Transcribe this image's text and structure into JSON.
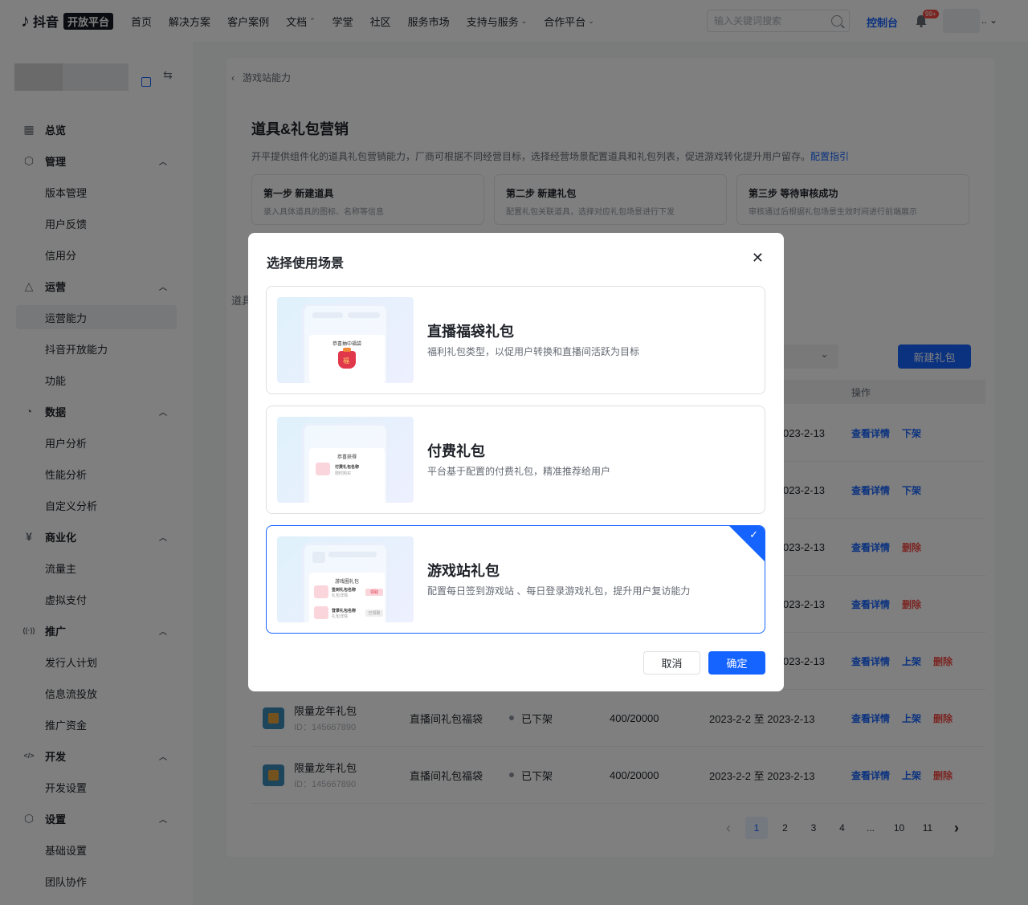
{
  "header": {
    "logo_text": "抖音",
    "logo_badge": "开放平台",
    "nav": [
      "首页",
      "解决方案",
      "客户案例",
      "文档",
      "学堂",
      "社区",
      "服务市场",
      "支持与服务",
      "合作平台"
    ],
    "nav_dropdowns": [
      false,
      false,
      false,
      true,
      false,
      false,
      false,
      true,
      true
    ],
    "search_placeholder": "输入关键词搜索",
    "console": "控制台",
    "bell_badge": "99+",
    "user_name": ".."
  },
  "sidebar": {
    "groups": [
      {
        "label": "总览",
        "icon": "dashboard-icon",
        "items": []
      },
      {
        "label": "管理",
        "icon": "cube-icon",
        "items": [
          "版本管理",
          "用户反馈",
          "信用分"
        ]
      },
      {
        "label": "运营",
        "icon": "operation-icon",
        "items": [
          "运营能力",
          "抖音开放能力",
          "功能"
        ]
      },
      {
        "label": "数据",
        "icon": "pie-chart-icon",
        "items": [
          "用户分析",
          "性能分析",
          "自定义分析"
        ]
      },
      {
        "label": "商业化",
        "icon": "yuan-icon",
        "items": [
          "流量主",
          "虚拟支付"
        ]
      },
      {
        "label": "推广",
        "icon": "broadcast-icon",
        "items": [
          "发行人计划",
          "信息流投放",
          "推广资金"
        ]
      },
      {
        "label": "开发",
        "icon": "code-icon",
        "items": [
          "开发设置"
        ]
      },
      {
        "label": "设置",
        "icon": "settings-icon",
        "items": [
          "基础设置",
          "团队协作"
        ]
      }
    ],
    "active_item": "运营能力"
  },
  "page": {
    "breadcrumb": "游戏站能力",
    "title": "道具&礼包营销",
    "desc": "开平提供组件化的道具礼包营销能力，厂商可根据不同经营目标，选择经营场景配置道具和礼包列表，促进游戏转化提升用户留存。",
    "desc_link": "配置指引",
    "steps": [
      {
        "title": "第一步 新建道具",
        "desc": "录入具体道具的图标、名称等信息"
      },
      {
        "title": "第二步 新建礼包",
        "desc": "配置礼包关联道具，选择对应礼包场景进行下发"
      },
      {
        "title": "第三步 等待审核成功",
        "desc": "审核通过后根据礼包场景生效时间进行前端展示"
      }
    ],
    "tab_label": "道具",
    "new_button": "新建礼包",
    "op_header": "操作",
    "date_tails": [
      "023-2-13",
      "023-2-13",
      "023-2-13",
      "023-2-13",
      "023-2-13"
    ],
    "partial_actions": [
      [
        "查看详情",
        "下架"
      ],
      [
        "查看详情",
        "下架"
      ],
      [
        "查看详情",
        "删除"
      ],
      [
        "查看详情",
        "删除"
      ],
      [
        "查看详情",
        "上架",
        "删除"
      ]
    ],
    "rows": [
      {
        "name": "限量龙年礼包",
        "id": "ID：145667890",
        "type": "直播间礼包福袋",
        "status": "已下架",
        "stock": "400/20000",
        "date": "2023-2-2 至 2023-2-13",
        "actions": [
          "查看详情",
          "上架",
          "删除"
        ]
      },
      {
        "name": "限量龙年礼包",
        "id": "ID：145667890",
        "type": "直播间礼包福袋",
        "status": "已下架",
        "stock": "400/20000",
        "date": "2023-2-2 至 2023-2-13",
        "actions": [
          "查看详情",
          "上架",
          "删除"
        ]
      }
    ],
    "pagination": [
      "1",
      "2",
      "3",
      "4",
      "...",
      "10",
      "11"
    ],
    "current_page": "1"
  },
  "modal": {
    "title": "选择使用场景",
    "scenes": [
      {
        "name": "直播福袋礼包",
        "desc": "福利礼包类型，以促用户转换和直播间活跃为目标",
        "selected": false,
        "preview_text": "恭喜抽中福袋",
        "preview_bag": "福"
      },
      {
        "name": "付费礼包",
        "desc": "平台基于配置的付费礼包，精准推荐给用户",
        "selected": false,
        "preview_text": "恭喜获得",
        "preview_item": "付费礼包名称",
        "preview_sub": "限时购买"
      },
      {
        "name": "游戏站礼包",
        "desc": "配置每日签到游戏站 、每日登录游戏礼包，提升用户复访能力",
        "selected": true,
        "preview_text": "游戏圈礼包",
        "preview_item1": "签到礼包名称",
        "preview_item2": "登录礼包名称",
        "preview_sub": "礼包详情",
        "preview_btn1": "领取",
        "preview_btn2": "已领取"
      }
    ],
    "cancel": "取消",
    "confirm": "确定"
  }
}
